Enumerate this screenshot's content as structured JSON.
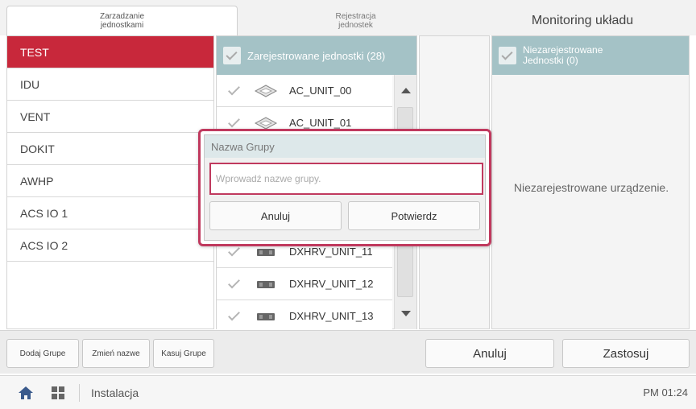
{
  "tabs": [
    {
      "label": "Zarzadzanie\njednostkami"
    },
    {
      "label": "Rejestracja\njednostek"
    },
    {
      "label": "Monitoring układu"
    }
  ],
  "groups": [
    {
      "label": "TEST",
      "selected": true
    },
    {
      "label": "IDU"
    },
    {
      "label": "VENT"
    },
    {
      "label": "DOKIT"
    },
    {
      "label": "AWHP"
    },
    {
      "label": "ACS IO 1"
    },
    {
      "label": "ACS IO 2"
    }
  ],
  "registered": {
    "header": "Zarejestrowane jednostki (28)",
    "units": [
      {
        "name": "AC_UNIT_00",
        "icon": "cassette-unit-icon"
      },
      {
        "name": "AC_UNIT_01",
        "icon": "cassette-unit-icon"
      },
      {
        "name": "DXHRV_UNIT_11",
        "icon": "hrv-unit-icon"
      },
      {
        "name": "DXHRV_UNIT_12",
        "icon": "hrv-unit-icon"
      },
      {
        "name": "DXHRV_UNIT_13",
        "icon": "hrv-unit-icon"
      }
    ]
  },
  "unregistered": {
    "header": "Niezarejestrowane\nJednostki (0)",
    "empty_text": "Niezarejestrowane urządzenie."
  },
  "actions": {
    "add_group": "Dodaj Grupe",
    "rename": "Zmień nazwe",
    "delete_group": "Kasuj Grupe",
    "cancel": "Anuluj",
    "apply": "Zastosuj"
  },
  "footer": {
    "title": "Instalacja",
    "clock": "PM 01:24"
  },
  "dialog": {
    "title": "Nazwa Grupy",
    "input_placeholder": "Wprowadź nazwe grupy.",
    "input_value": "",
    "cancel": "Anuluj",
    "confirm": "Potwierdz"
  },
  "colors": {
    "accent": "#c8283b",
    "dialog_border": "#c0395e",
    "header_teal": "#a4c2c6"
  }
}
